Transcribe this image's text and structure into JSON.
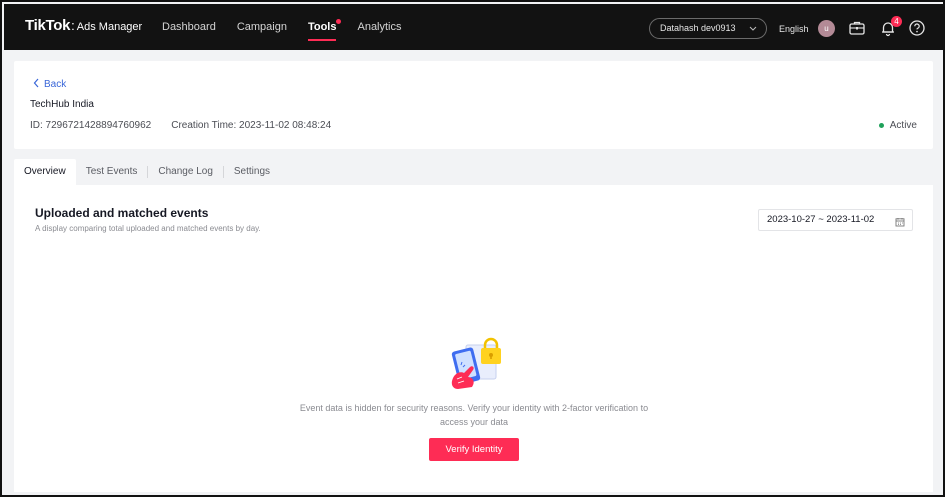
{
  "topbar": {
    "logo_main": "TikTok",
    "logo_dot": ":",
    "logo_sub": "Ads Manager",
    "nav": [
      {
        "label": "Dashboard"
      },
      {
        "label": "Campaign"
      },
      {
        "label": "Tools"
      },
      {
        "label": "Analytics"
      }
    ],
    "active_nav": "Tools",
    "account_selected": "Datahash dev0913",
    "language": "English",
    "avatar_initial": "u",
    "notification_count": "4",
    "icons": [
      "briefcase-icon",
      "bell-icon",
      "help-icon"
    ]
  },
  "header": {
    "back_label": "Back",
    "advertiser_name": "TechHub India",
    "id_text": "ID: 7296721428894760962",
    "creation_time_text": "Creation Time: 2023-11-02 08:48:24",
    "status_label": "Active",
    "status_color": "#1fa15a"
  },
  "tabs": [
    {
      "label": "Overview"
    },
    {
      "label": "Test Events"
    },
    {
      "label": "Change Log"
    },
    {
      "label": "Settings"
    }
  ],
  "active_tab": "Overview",
  "main": {
    "title": "Uploaded and matched events",
    "subtitle": "A display comparing total uploaded and matched events by day.",
    "date_range": "2023-10-27 ~ 2023-11-02",
    "hidden_message_line1": "Event data is hidden for security reasons. Verify your identity with 2-factor verification to",
    "hidden_message_line2": "access your data",
    "verify_button_label": "Verify Identity"
  },
  "colors": {
    "accent": "#fe2c55",
    "link": "#3966d8",
    "topbar_bg": "#121212"
  }
}
